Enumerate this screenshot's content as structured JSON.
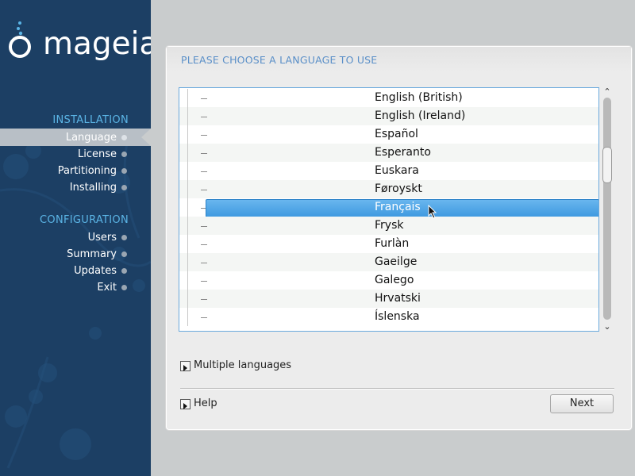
{
  "logo": {
    "text": "mageia"
  },
  "sidebar": {
    "sections": [
      {
        "title": "INSTALLATION",
        "steps": [
          {
            "label": "Language",
            "active": true
          },
          {
            "label": "License",
            "active": false
          },
          {
            "label": "Partitioning",
            "active": false
          },
          {
            "label": "Installing",
            "active": false
          }
        ]
      },
      {
        "title": "CONFIGURATION",
        "steps": [
          {
            "label": "Users",
            "active": false
          },
          {
            "label": "Summary",
            "active": false
          },
          {
            "label": "Updates",
            "active": false
          },
          {
            "label": "Exit",
            "active": false
          }
        ]
      }
    ]
  },
  "panel": {
    "title": "PLEASE CHOOSE A LANGUAGE TO USE"
  },
  "languages": [
    {
      "label": "English (British)",
      "selected": false
    },
    {
      "label": "English (Ireland)",
      "selected": false
    },
    {
      "label": "Español",
      "selected": false
    },
    {
      "label": "Esperanto",
      "selected": false
    },
    {
      "label": "Euskara",
      "selected": false
    },
    {
      "label": "Føroyskt",
      "selected": false
    },
    {
      "label": "Français",
      "selected": true
    },
    {
      "label": "Frysk",
      "selected": false
    },
    {
      "label": "Furlàn",
      "selected": false
    },
    {
      "label": "Gaeilge",
      "selected": false
    },
    {
      "label": "Galego",
      "selected": false
    },
    {
      "label": "Hrvatski",
      "selected": false
    },
    {
      "label": "Íslenska",
      "selected": false
    }
  ],
  "multiple_languages": {
    "label": "Multiple languages"
  },
  "help": {
    "label": "Help"
  },
  "next_button": {
    "label": "Next"
  },
  "colors": {
    "sidebar_bg": "#1c3f64",
    "section_title": "#5bb5e6",
    "panel_title": "#5a8fc8",
    "selection": "#3f9ae0"
  }
}
